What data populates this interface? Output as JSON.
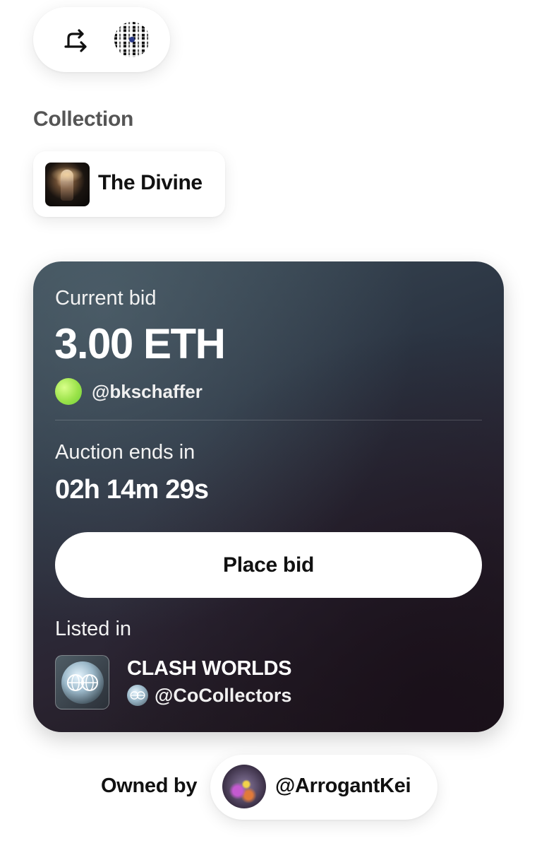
{
  "toolbar": {
    "share_icon": "share-forward-icon",
    "qr_icon": "qr-code-icon"
  },
  "collection": {
    "label": "Collection",
    "name": "The Divine"
  },
  "auction": {
    "current_bid_label": "Current bid",
    "current_bid_amount": "3.00 ETH",
    "bidder_handle": "@bkschaffer",
    "bidder_avatar_color": "#9be34a",
    "ends_label": "Auction ends in",
    "countdown": "02h 14m 29s",
    "place_bid_label": "Place bid",
    "listed_label": "Listed in",
    "listed_title": "CLASH WORLDS",
    "listed_owner": "@CoCollectors"
  },
  "owner": {
    "label": "Owned by",
    "handle": "@ArrogantKei"
  }
}
